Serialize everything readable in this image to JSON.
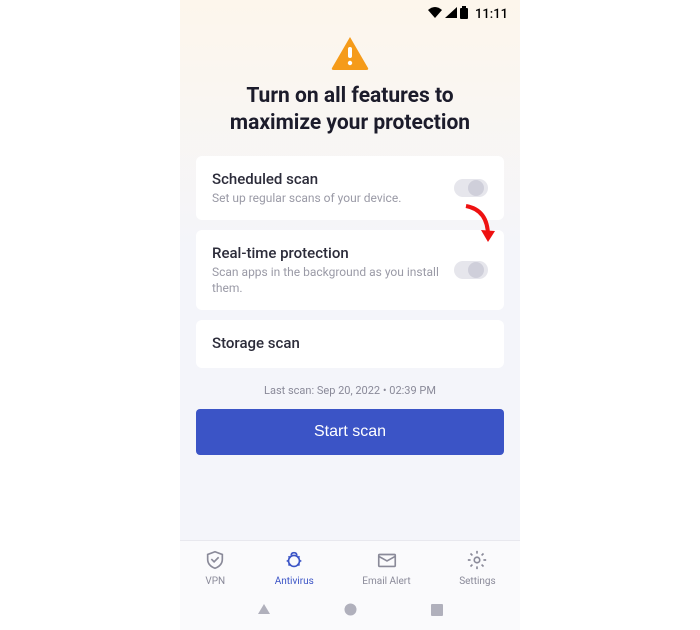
{
  "statusBar": {
    "time": "11:11"
  },
  "hero": {
    "title_line1": "Turn on all features to",
    "title_line2": "maximize your protection"
  },
  "features": {
    "scheduled": {
      "title": "Scheduled scan",
      "desc": "Set up regular scans of your device."
    },
    "realtime": {
      "title": "Real-time protection",
      "desc": "Scan apps in the background as you install them."
    },
    "storage": {
      "title": "Storage scan"
    }
  },
  "lastScan": "Last scan: Sep 20, 2022 • 02:39 PM",
  "startBtn": "Start scan",
  "nav": {
    "vpn": "VPN",
    "antivirus": "Antivirus",
    "emailAlert": "Email Alert",
    "settings": "Settings"
  },
  "colors": {
    "accent": "#3b54c6",
    "warning": "#f59b1a",
    "annotation": "#e11"
  }
}
